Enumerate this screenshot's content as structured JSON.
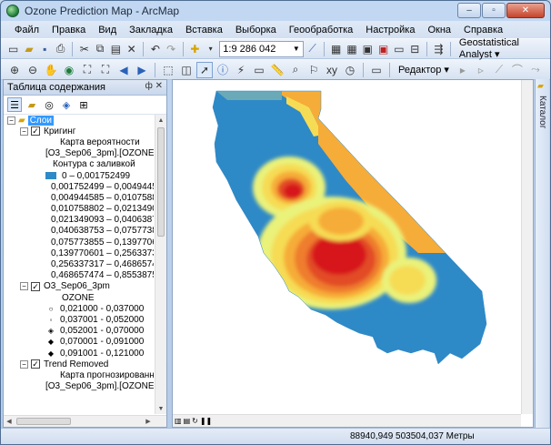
{
  "window": {
    "title": "Ozone Prediction Map - ArcMap",
    "controls": [
      "–",
      "▫",
      "✕"
    ]
  },
  "menu": [
    "Файл",
    "Правка",
    "Вид",
    "Закладка",
    "Вставка",
    "Выборка",
    "Геообработка",
    "Настройка",
    "Окна",
    "Справка"
  ],
  "toolbar1": {
    "scale": "1:9 286 042",
    "geostat_label": "Geostatistical Analyst ▾"
  },
  "toolbar2": {
    "editor_label": "Редактор ▾"
  },
  "toc": {
    "title": "Таблица содержания",
    "header_icons": "ф ✕",
    "layers_label": "Слои",
    "kriging": {
      "name": "Кригинг",
      "prob_map_line1": "Карта вероятности",
      "prob_map_line2": "[O3_Sep06_3pm].[OZONE]",
      "filled_contours": "Контура с заливкой",
      "classes": [
        {
          "label": "0 – 0,001752499",
          "color": "#2e89c7"
        },
        {
          "label": "0,001752499 – 0,004944585",
          "color": "#6aa9b8"
        },
        {
          "label": "0,004944585 – 0,010758802",
          "color": "#9cc6a4"
        },
        {
          "label": "0,010758802 – 0,021349093",
          "color": "#c7df8e"
        },
        {
          "label": "0,021349093 – 0,040638753",
          "color": "#eaf27a"
        },
        {
          "label": "0,040638753 – 0,075773855",
          "color": "#f6dc54"
        },
        {
          "label": "0,075773855 – 0,139770601",
          "color": "#f6ac38"
        },
        {
          "label": "0,139770601 – 0,256337317",
          "color": "#ef7d2e"
        },
        {
          "label": "0,256337317 – 0,468657474",
          "color": "#e24c25"
        },
        {
          "label": "0,468657474 – 0,855387501",
          "color": "#d7191c"
        }
      ]
    },
    "points": {
      "name": "O3_Sep06_3pm",
      "field": "OZONE",
      "classes": [
        {
          "label": "0,021000 - 0,037000",
          "symbol": "○"
        },
        {
          "label": "0,037001 - 0,052000",
          "symbol": "◦"
        },
        {
          "label": "0,052001 - 0,070000",
          "symbol": "◈"
        },
        {
          "label": "0,070001 - 0,091000",
          "symbol": "◆"
        },
        {
          "label": "0,091001 - 0,121000",
          "symbol": "◆"
        }
      ]
    },
    "trend": {
      "name": "Trend Removed",
      "line1": "Карта прогнозированны",
      "line2": "[O3_Sep06_3pm].[OZONE]"
    }
  },
  "catalog_tab": "Каталог",
  "status": {
    "coords": "88940,949  503504,037 Метры"
  }
}
